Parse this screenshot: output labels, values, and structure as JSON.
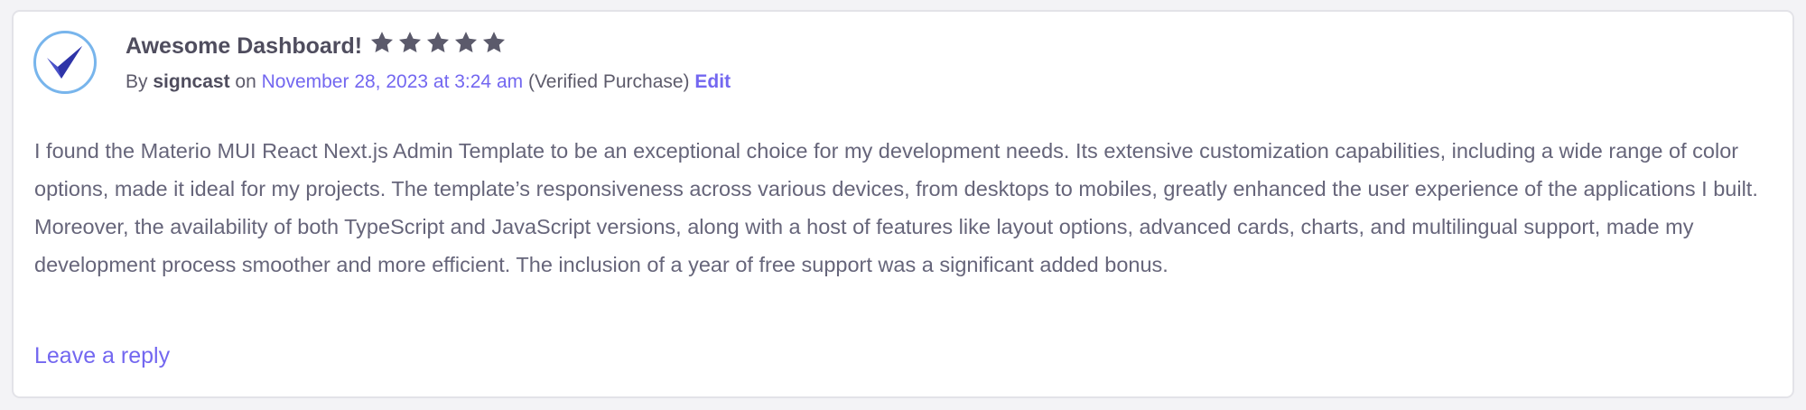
{
  "review": {
    "title": "Awesome Dashboard!",
    "rating": 5,
    "rating_max": 5,
    "by_prefix": "By",
    "author": "signcast",
    "on_text": "on",
    "date": "November 28, 2023 at 3:24 am",
    "verified": "(Verified Purchase)",
    "edit_label": "Edit",
    "body": "I found the Materio MUI React Next.js Admin Template to be an exceptional choice for my development needs. Its extensive customization capabilities, including a wide range of color options, made it ideal for my projects. The template’s responsiveness across various devices, from desktops to mobiles, greatly enhanced the user experience of the applications I built. Moreover, the availability of both TypeScript and JavaScript versions, along with a host of features like layout options, advanced cards, charts, and multilingual support, made my development process smoother and more efficient. The inclusion of a year of free support was a significant added bonus.",
    "reply_label": "Leave a reply"
  },
  "icons": {
    "avatar": "checkmark-logo-icon",
    "star": "star-icon"
  },
  "colors": {
    "accent": "#7367f0",
    "avatar_ring": "#78b5ec",
    "star": "#5b5a6b",
    "title": "#4f4d5e",
    "body": "#66657a"
  }
}
